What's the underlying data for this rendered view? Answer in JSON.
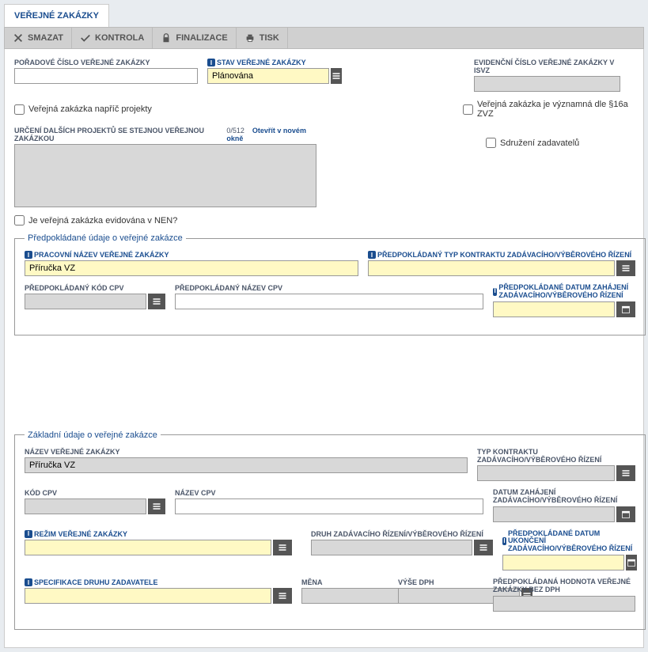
{
  "tab": "VEŘEJNÉ ZAKÁZKY",
  "toolbar": {
    "delete": "SMAZAT",
    "check": "KONTROLA",
    "finalize": "FINALIZACE",
    "print": "TISK"
  },
  "top": {
    "poradove_label": "POŘADOVÉ ČÍSLO VEŘEJNÉ ZAKÁZKY",
    "poradove_value": "",
    "stav_label": "STAV VEŘEJNÉ ZAKÁZKY",
    "stav_value": "Plánována",
    "evidencni_label": "EVIDENČNÍ ČÍSLO VEŘEJNÉ ZAKÁZKY V ISVZ",
    "evidencni_value": "",
    "chk_napric": "Veřejná zakázka napříč projekty",
    "chk_vyznamna": "Veřejná zakázka je významná dle §16a ZVZ",
    "urceni_label": "URČENÍ DALŠÍCH PROJEKTŮ SE STEJNOU VEŘEJNOU ZAKÁZKOU",
    "urceni_counter": "0/512",
    "urceni_link": "Otevřít v novém okně",
    "chk_sdruzeni": "Sdružení zadavatelů",
    "chk_nen": "Je veřejná zakázka evidována v NEN?"
  },
  "predpokladane": {
    "legend": "Předpokládané údaje o veřejné zakázce",
    "pracovni_label": "PRACOVNÍ NÁZEV VEŘEJNÉ ZAKÁZKY",
    "pracovni_value": "Příručka VZ",
    "typ_label": "PŘEDPOKLÁDANÝ TYP KONTRAKTU ZADÁVACÍHO/VÝBĚROVÉHO ŘÍZENÍ",
    "typ_value": "",
    "kod_cpv_label": "PŘEDPOKLÁDANÝ KÓD CPV",
    "kod_cpv_value": "",
    "nazev_cpv_label": "PŘEDPOKLÁDANÝ NÁZEV CPV",
    "nazev_cpv_value": "",
    "datum_zahajeni_label": "PŘEDPOKLÁDANÉ DATUM ZAHÁJENÍ ZADÁVACÍHO/VÝBĚROVÉHO ŘÍZENÍ",
    "datum_zahajeni_value": ""
  },
  "zakladni": {
    "legend": "Základní údaje o veřejné zakázce",
    "nazev_label": "NÁZEV VEŘEJNÉ ZAKÁZKY",
    "nazev_value": "Příručka VZ",
    "typ_label": "TYP KONTRAKTU ZADÁVACÍHO/VÝBĚROVÉHO ŘÍZENÍ",
    "typ_value": "",
    "kod_cpv_label": "KÓD CPV",
    "kod_cpv_value": "",
    "nazev_cpv_label": "NÁZEV CPV",
    "nazev_cpv_value": "",
    "datum_zahajeni_label": "DATUM ZAHÁJENÍ ZADÁVACÍHO/VÝBĚROVÉHO ŘÍZENÍ",
    "datum_zahajeni_value": "",
    "rezim_label": "REŽIM VEŘEJNÉ ZAKÁZKY",
    "rezim_value": "",
    "druh_label": "DRUH ZADÁVACÍHO ŘÍZENÍ/VÝBĚROVÉHO ŘÍZENÍ",
    "druh_value": "",
    "datum_ukonceni_label": "PŘEDPOKLÁDANÉ DATUM UKONČENÍ ZADÁVACÍHO/VÝBĚROVÉHO ŘÍZENÍ",
    "datum_ukonceni_value": "",
    "specifikace_label": "SPECIFIKACE DRUHU ZADAVATELE",
    "specifikace_value": "",
    "mena_label": "MĚNA",
    "mena_value": "",
    "vyse_dph_label": "VÝŠE DPH",
    "vyse_dph_value": "",
    "hodnota_label": "PŘEDPOKLÁDANÁ HODNOTA VEŘEJNÉ ZAKÁZKY BEZ DPH",
    "hodnota_value": ""
  }
}
